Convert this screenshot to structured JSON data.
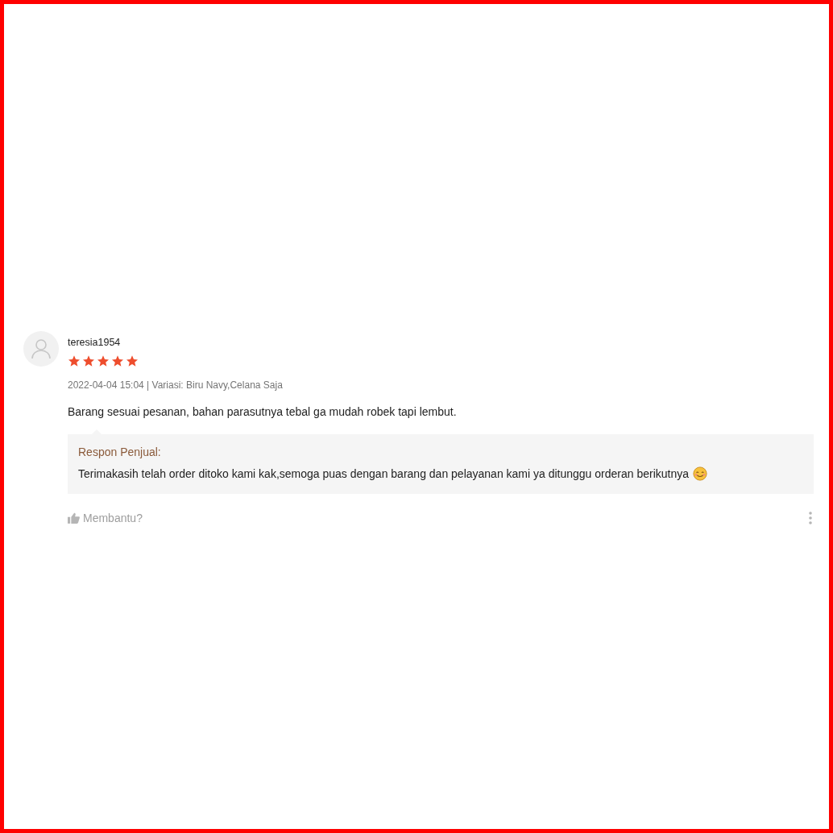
{
  "review": {
    "username": "teresia1954",
    "stars": 5,
    "meta": "2022-04-04 15:04 | Variasi: Biru Navy,Celana Saja",
    "comment": "Barang sesuai pesanan, bahan parasutnya tebal ga mudah robek tapi lembut.",
    "seller_response": {
      "title": "Respon Penjual:",
      "text": "Terimakasih telah order ditoko kami kak,semoga puas dengan barang dan pelayanan kami ya ditunggu orderan berikutnya"
    },
    "helpful_label": "Membantu?"
  }
}
